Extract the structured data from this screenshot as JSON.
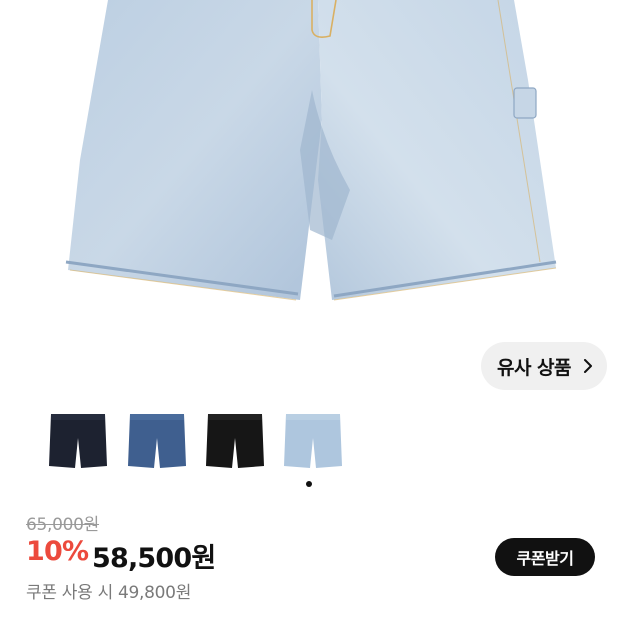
{
  "product": {
    "hero_image": "light-wash denim shorts photo",
    "similar_label": "유사 상품",
    "thumbnails": [
      {
        "name": "black",
        "color": "#1d2230"
      },
      {
        "name": "medium-wash",
        "color": "#3f5f8f"
      },
      {
        "name": "black-denim",
        "color": "#161616"
      },
      {
        "name": "light-wash",
        "color": "#aec6de"
      }
    ],
    "selected_thumbnail": 3
  },
  "pricing": {
    "original_price": "65,000원",
    "discount_percent": "10%",
    "sale_price": "58,500원",
    "coupon_text": "쿠폰 사용 시 49,800원",
    "coupon_button": "쿠폰받기"
  },
  "colors": {
    "discount": "#ec4a3d",
    "button_bg": "#111111",
    "pill_bg": "#f0f0f0"
  }
}
